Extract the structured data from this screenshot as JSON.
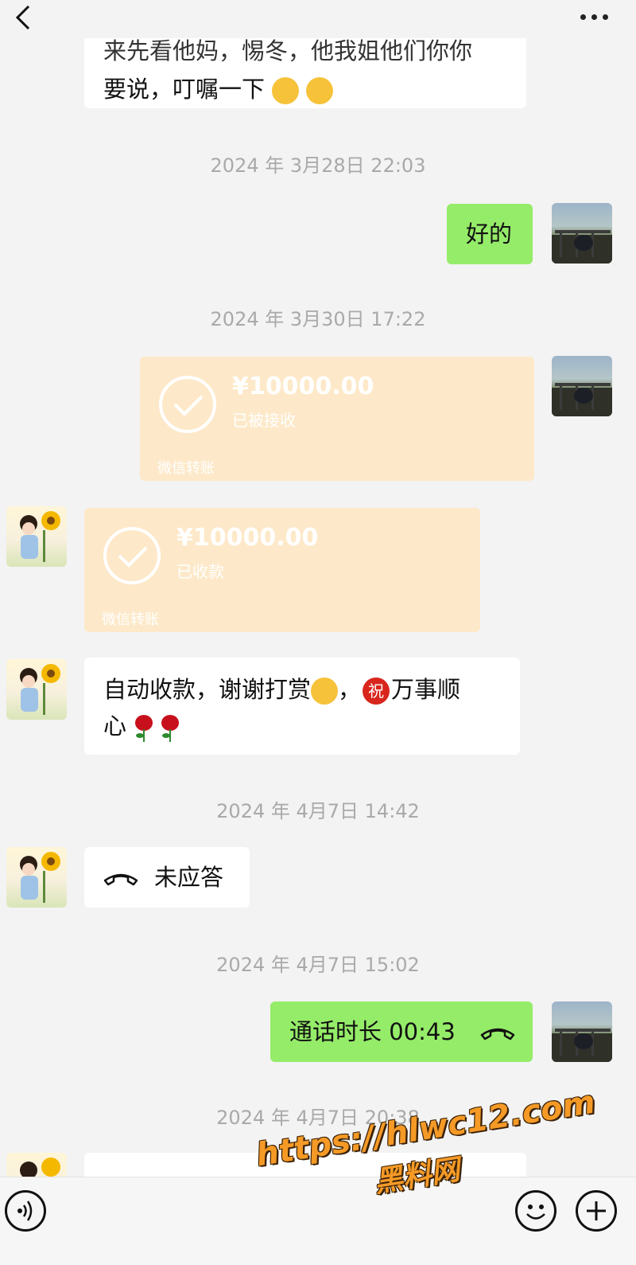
{
  "header": {
    "back_icon": "chevron-left-icon",
    "more_icon": "more-dots-icon"
  },
  "messages": {
    "first_partial_line": "来先看他妈，惕冬，他我姐他们你你",
    "first_text": "要说，叮嘱一下",
    "time1": "2024 年 3月28日 22:03",
    "reply_ok": "好的",
    "time2": "2024 年 3月30日 17:22",
    "transfer_sent": {
      "amount": "¥10000.00",
      "status": "已被接收",
      "label": "微信转账"
    },
    "transfer_received": {
      "amount": "¥10000.00",
      "status": "已收款",
      "label": "微信转账"
    },
    "auto_reply_part1": "自动收款，谢谢打赏",
    "auto_reply_part2": "，",
    "auto_reply_zhu": "祝",
    "auto_reply_part3": "万事顺",
    "auto_reply_line2": "心",
    "time3": "2024 年 4月7日 14:42",
    "missed_call": "未应答",
    "time4": "2024 年 4月7日 15:02",
    "call_duration": "通话时长 00:43",
    "time5": "2024 年 4月7日 20:38"
  },
  "watermark": {
    "url": "https://hlwc12.com",
    "site": "黑料网"
  },
  "bottom": {
    "voice_icon": "voice-icon",
    "emoji_icon": "emoji-icon",
    "plus_icon": "plus-icon"
  },
  "colors": {
    "self_bubble": "#95ec69",
    "other_bubble": "#ffffff",
    "transfer_card": "#fde9c9",
    "background": "#f3f3f3"
  }
}
